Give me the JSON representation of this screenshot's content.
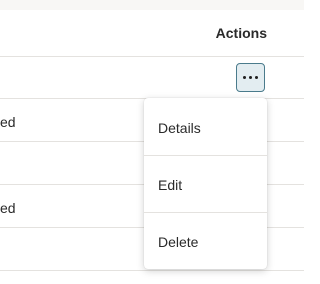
{
  "table": {
    "actions_header": "Actions",
    "rows": [
      {
        "status_fragment": ""
      },
      {
        "status_fragment": "ed"
      },
      {
        "status_fragment": ""
      },
      {
        "status_fragment": "ed"
      },
      {
        "status_fragment": ""
      }
    ]
  },
  "more_button": {
    "icon": "ellipsis-icon"
  },
  "menu": {
    "items": [
      {
        "label": "Details"
      },
      {
        "label": "Edit"
      },
      {
        "label": "Delete"
      }
    ]
  }
}
